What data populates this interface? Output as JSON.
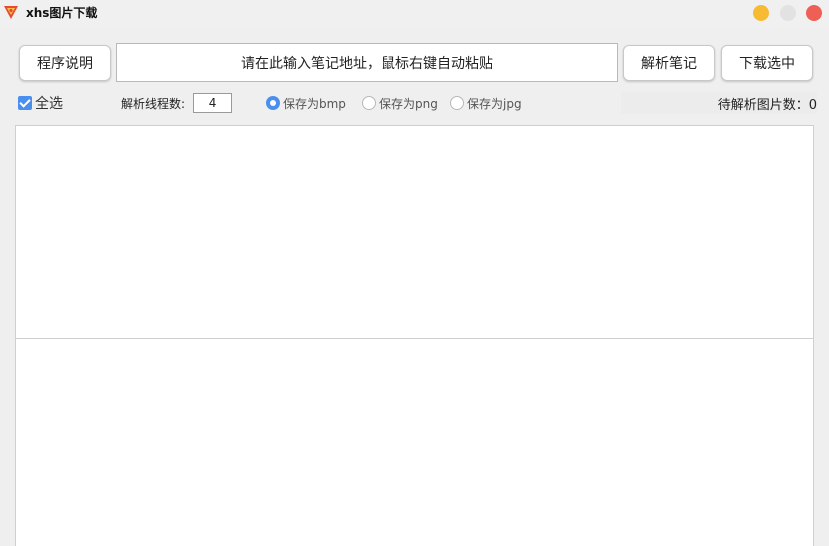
{
  "window": {
    "title": "xhs图片下载",
    "colors": {
      "minimize": "#f6bb33",
      "maximize": "#e2e2e2",
      "close": "#ee5f55"
    }
  },
  "toolbar": {
    "about_label": "程序说明",
    "url_placeholder": "请在此输入笔记地址，鼠标右键自动粘贴",
    "parse_label": "解析笔记",
    "download_label": "下载选中"
  },
  "options": {
    "select_all_label": "全选",
    "select_all_checked": true,
    "threads_label": "解析线程数:",
    "threads_value": "4",
    "formats": [
      {
        "label": "保存为bmp",
        "selected": true
      },
      {
        "label": "保存为png",
        "selected": false
      },
      {
        "label": "保存为jpg",
        "selected": false
      }
    ]
  },
  "status": {
    "pending_text": "待解析图片数：0"
  },
  "accent_color": "#4a8ff0"
}
